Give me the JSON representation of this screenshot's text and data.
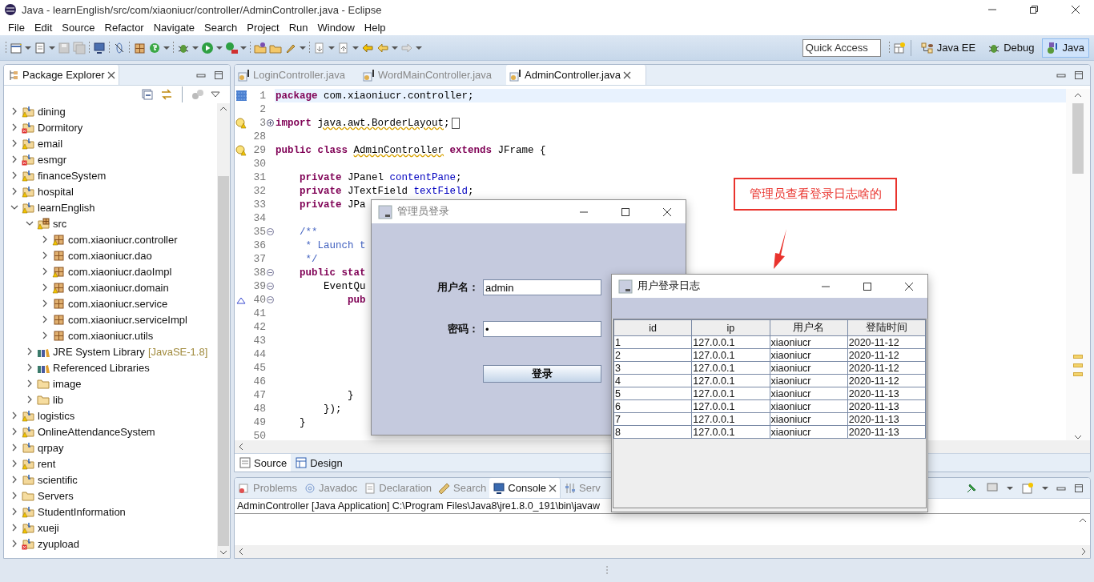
{
  "window": {
    "title": "Java - learnEnglish/src/com/xiaoniucr/controller/AdminController.java - Eclipse"
  },
  "menu": [
    "File",
    "Edit",
    "Source",
    "Refactor",
    "Navigate",
    "Search",
    "Project",
    "Run",
    "Window",
    "Help"
  ],
  "toolbar": {
    "quick_access": {
      "placeholder": "Quick Access"
    },
    "perspectives": [
      {
        "label": "Java EE",
        "kind": "javaee",
        "selected": false
      },
      {
        "label": "Debug",
        "kind": "debug",
        "selected": false
      },
      {
        "label": "Java",
        "kind": "java",
        "selected": true
      }
    ]
  },
  "explorer": {
    "title": "Package Explorer",
    "items": [
      {
        "label": "dining",
        "kind": "project",
        "warning": true,
        "expanded": false
      },
      {
        "label": "Dormitory",
        "kind": "project",
        "error": true,
        "expanded": false
      },
      {
        "label": "email",
        "kind": "project",
        "warning": true,
        "expanded": false
      },
      {
        "label": "esmgr",
        "kind": "project",
        "error": true,
        "expanded": false
      },
      {
        "label": "financeSystem",
        "kind": "project",
        "warning": true,
        "expanded": false
      },
      {
        "label": "hospital",
        "kind": "project",
        "warning": true,
        "expanded": false
      },
      {
        "label": "learnEnglish",
        "kind": "project",
        "warning": true,
        "expanded": true,
        "children": [
          {
            "label": "src",
            "kind": "source-folder",
            "warning": true,
            "expanded": true,
            "children": [
              {
                "label": "com.xiaoniucr.controller",
                "kind": "package",
                "warning": true,
                "expanded": false
              },
              {
                "label": "com.xiaoniucr.dao",
                "kind": "package",
                "expanded": false
              },
              {
                "label": "com.xiaoniucr.daoImpl",
                "kind": "package",
                "warning": true,
                "expanded": false
              },
              {
                "label": "com.xiaoniucr.domain",
                "kind": "package",
                "warning": true,
                "expanded": false
              },
              {
                "label": "com.xiaoniucr.service",
                "kind": "package",
                "expanded": false
              },
              {
                "label": "com.xiaoniucr.serviceImpl",
                "kind": "package",
                "expanded": false
              },
              {
                "label": "com.xiaoniucr.utils",
                "kind": "package",
                "expanded": false
              }
            ]
          },
          {
            "label": "JRE System Library",
            "decoration": "[JavaSE-1.8]",
            "kind": "library",
            "expanded": false
          },
          {
            "label": "Referenced Libraries",
            "kind": "library",
            "expanded": false
          },
          {
            "label": "image",
            "kind": "folder",
            "expanded": false
          },
          {
            "label": "lib",
            "kind": "folder",
            "expanded": false
          }
        ]
      },
      {
        "label": "logistics",
        "kind": "project",
        "warning": true,
        "expanded": false
      },
      {
        "label": "OnlineAttendanceSystem",
        "kind": "project",
        "warning": true,
        "expanded": false
      },
      {
        "label": "qrpay",
        "kind": "project",
        "expanded": false
      },
      {
        "label": "rent",
        "kind": "project",
        "warning": true,
        "expanded": false
      },
      {
        "label": "scientific",
        "kind": "project",
        "expanded": false
      },
      {
        "label": "Servers",
        "kind": "folder",
        "expanded": false
      },
      {
        "label": "StudentInformation",
        "kind": "project",
        "warning": true,
        "expanded": false
      },
      {
        "label": "xueji",
        "kind": "project",
        "warning": true,
        "expanded": false
      },
      {
        "label": "zyupload",
        "kind": "project",
        "error": true,
        "expanded": false
      }
    ]
  },
  "editor": {
    "tabs": [
      {
        "label": "LoginController.java",
        "selected": false
      },
      {
        "label": "WordMainController.java",
        "selected": false
      },
      {
        "label": "AdminController.java",
        "selected": true
      }
    ],
    "lines": [
      {
        "number": "1",
        "current": true,
        "bookmark": true,
        "segments": [
          {
            "kind": "keyword",
            "text": "package"
          },
          {
            "kind": "plain",
            "text": " com.xiaoniucr.controller;"
          }
        ]
      },
      {
        "number": "2"
      },
      {
        "number": "3",
        "warning": true,
        "collapsed": true,
        "segments": [
          {
            "kind": "keyword",
            "text": "import "
          },
          {
            "kind": "warned",
            "text": "java.awt.BorderLayout"
          },
          {
            "kind": "plain",
            "text": ";"
          }
        ]
      },
      {
        "number": "28"
      },
      {
        "number": "29",
        "warning": true,
        "segments": [
          {
            "kind": "keyword",
            "text": "public class "
          },
          {
            "kind": "warned",
            "text": "AdminController"
          },
          {
            "kind": "keyword",
            "text": " extends"
          },
          {
            "kind": "plain",
            "text": " JFrame {"
          }
        ]
      },
      {
        "number": "30"
      },
      {
        "number": "31",
        "segments": [
          {
            "kind": "keyword",
            "text": "    private"
          },
          {
            "kind": "plain",
            "text": " JPanel "
          },
          {
            "kind": "field",
            "text": "contentPane"
          },
          {
            "kind": "plain",
            "text": ";"
          }
        ]
      },
      {
        "number": "32",
        "segments": [
          {
            "kind": "keyword",
            "text": "    private"
          },
          {
            "kind": "plain",
            "text": " JTextField "
          },
          {
            "kind": "field",
            "text": "textField"
          },
          {
            "kind": "plain",
            "text": ";"
          }
        ]
      },
      {
        "number": "33",
        "segments": [
          {
            "kind": "keyword",
            "text": "    private"
          },
          {
            "kind": "plain",
            "text": " JPa"
          }
        ]
      },
      {
        "number": "34"
      },
      {
        "number": "35",
        "collapsed": false,
        "segments": [
          {
            "kind": "comment",
            "text": "    /**"
          }
        ]
      },
      {
        "number": "36",
        "segments": [
          {
            "kind": "comment",
            "text": "     * Launch t"
          }
        ]
      },
      {
        "number": "37",
        "segments": [
          {
            "kind": "comment",
            "text": "     */"
          }
        ]
      },
      {
        "number": "38",
        "collapsed": false,
        "segments": [
          {
            "kind": "keyword",
            "text": "    public stat"
          }
        ]
      },
      {
        "number": "39",
        "collapsed": false,
        "segments": [
          {
            "kind": "plain",
            "text": "        EventQu"
          }
        ]
      },
      {
        "number": "40",
        "collapsed": false,
        "overrides": true,
        "segments": [
          {
            "kind": "keyword",
            "text": "            pub"
          }
        ]
      },
      {
        "number": "41"
      },
      {
        "number": "42"
      },
      {
        "number": "43"
      },
      {
        "number": "44"
      },
      {
        "number": "45"
      },
      {
        "number": "46"
      },
      {
        "number": "47",
        "segments": [
          {
            "kind": "plain",
            "text": "            }"
          }
        ]
      },
      {
        "number": "48",
        "segments": [
          {
            "kind": "plain",
            "text": "        });"
          }
        ]
      },
      {
        "number": "49",
        "segments": [
          {
            "kind": "plain",
            "text": "    }"
          }
        ]
      },
      {
        "number": "50"
      }
    ],
    "view_tabs": [
      {
        "label": "Source",
        "kind": "source",
        "selected": true
      },
      {
        "label": "Design",
        "kind": "design",
        "selected": false
      }
    ]
  },
  "console": {
    "tabs": [
      {
        "label": "Problems",
        "kind": "problems",
        "selected": false
      },
      {
        "label": "Javadoc",
        "kind": "javadoc",
        "selected": false
      },
      {
        "label": "Declaration",
        "kind": "declaration",
        "selected": false
      },
      {
        "label": "Search",
        "kind": "search",
        "selected": false
      },
      {
        "label": "Console",
        "kind": "console",
        "selected": true
      },
      {
        "label": "Serv",
        "kind": "servers",
        "selected": false
      }
    ],
    "launch": "AdminController [Java Application] C:\\Program Files\\Java8\\jre1.8.0_191\\bin\\javaw"
  },
  "login_dialog": {
    "title": "管理员登录",
    "fields": [
      {
        "label": "用户名：",
        "value": "admin"
      },
      {
        "label": "密码：",
        "value": "•"
      }
    ],
    "button": "登录"
  },
  "log_dialog": {
    "title": "用户登录日志",
    "columns": [
      "id",
      "ip",
      "用户名",
      "登陆时间"
    ],
    "rows": [
      [
        "1",
        "127.0.0.1",
        "xiaoniucr",
        "2020-11-12"
      ],
      [
        "2",
        "127.0.0.1",
        "xiaoniucr",
        "2020-11-12"
      ],
      [
        "3",
        "127.0.0.1",
        "xiaoniucr",
        "2020-11-12"
      ],
      [
        "4",
        "127.0.0.1",
        "xiaoniucr",
        "2020-11-12"
      ],
      [
        "5",
        "127.0.0.1",
        "xiaoniucr",
        "2020-11-13"
      ],
      [
        "6",
        "127.0.0.1",
        "xiaoniucr",
        "2020-11-13"
      ],
      [
        "7",
        "127.0.0.1",
        "xiaoniucr",
        "2020-11-13"
      ],
      [
        "8",
        "127.0.0.1",
        "xiaoniucr",
        "2020-11-13"
      ]
    ]
  },
  "annotation": "管理员查看登录日志啥的"
}
